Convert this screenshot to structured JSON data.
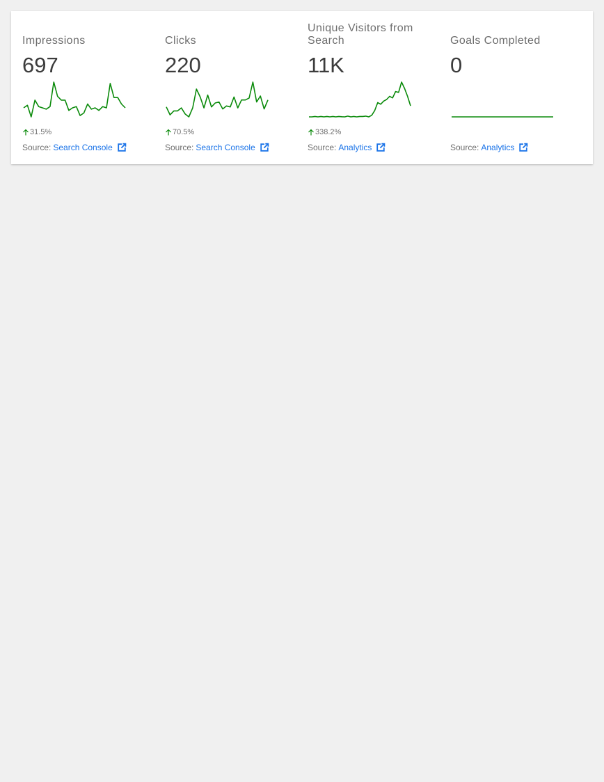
{
  "colors": {
    "positive": "#0a8a0a",
    "link": "#1a73e8",
    "text_muted": "#6e6e6e",
    "value": "#3c3c3c"
  },
  "source_prefix": "Source:",
  "tiles": [
    {
      "title": "Impressions",
      "value": "697",
      "change": "31.5%",
      "change_direction": "up",
      "source": "Search Console",
      "sparkline": [
        22,
        24,
        15,
        28,
        23,
        22,
        21,
        23,
        42,
        31,
        28,
        28,
        20,
        22,
        23,
        16,
        18,
        25,
        21,
        22,
        20,
        23,
        22,
        41,
        30,
        30,
        25,
        22
      ]
    },
    {
      "title": "Clicks",
      "value": "220",
      "change": "70.5%",
      "change_direction": "up",
      "source": "Search Console",
      "sparkline": [
        15,
        7,
        11,
        11,
        14,
        8,
        5,
        14,
        33,
        25,
        14,
        27,
        15,
        19,
        20,
        13,
        16,
        15,
        25,
        14,
        22,
        22,
        24,
        40,
        20,
        26,
        13,
        22
      ]
    },
    {
      "title": "Unique Visitors from Search",
      "value": "11K",
      "change": "338.2%",
      "change_direction": "up",
      "source": "Analytics",
      "sparkline": [
        4,
        4,
        4.5,
        4,
        4.5,
        4,
        4.5,
        4,
        4.5,
        4,
        4.5,
        4.2,
        4,
        5,
        4,
        4.5,
        4,
        4.5,
        4.5,
        5,
        4,
        6,
        12,
        22,
        20,
        24,
        26,
        30,
        28,
        36,
        35,
        48,
        40,
        30,
        18
      ]
    },
    {
      "title": "Goals Completed",
      "value": "0",
      "change": "",
      "change_direction": "",
      "source": "Analytics",
      "sparkline": [
        0,
        0,
        0,
        0,
        0,
        0,
        0,
        0,
        0,
        0,
        0,
        0,
        0,
        0,
        0,
        0,
        0,
        0,
        0,
        0,
        0,
        0,
        0,
        0,
        0,
        0,
        0,
        0
      ]
    }
  ]
}
